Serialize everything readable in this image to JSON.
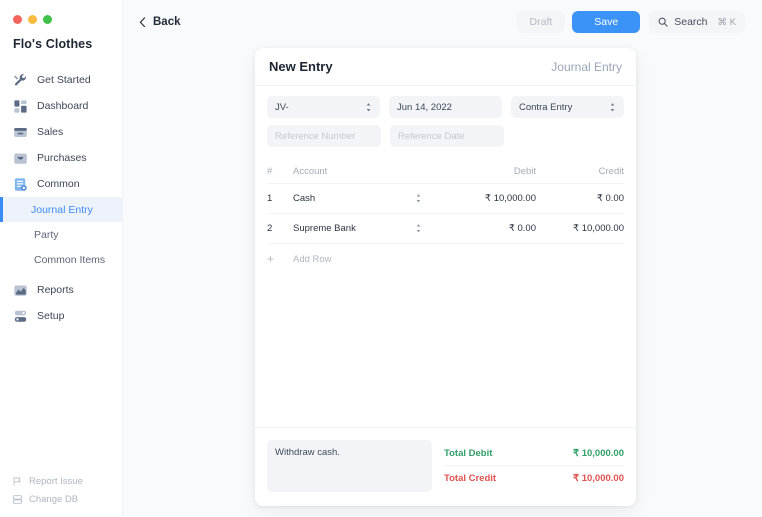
{
  "window": {
    "traffic_lights": [
      "close",
      "minimize",
      "maximize"
    ],
    "accent_blue": "#3b93f7",
    "green": "#2f9e68",
    "red": "#e0524f"
  },
  "sidebar": {
    "brand": "Flo's Clothes",
    "items": [
      {
        "label": "Get Started",
        "icon": "tools-icon"
      },
      {
        "label": "Dashboard",
        "icon": "dashboard-icon"
      },
      {
        "label": "Sales",
        "icon": "sales-icon"
      },
      {
        "label": "Purchases",
        "icon": "purchases-icon"
      },
      {
        "label": "Common",
        "icon": "common-icon"
      }
    ],
    "sub_items": [
      {
        "label": "Journal Entry",
        "active": true
      },
      {
        "label": "Party",
        "active": false
      },
      {
        "label": "Common Items",
        "active": false
      }
    ],
    "items_after": [
      {
        "label": "Reports",
        "icon": "reports-icon"
      },
      {
        "label": "Setup",
        "icon": "setup-icon"
      }
    ],
    "footer": [
      {
        "label": "Report Issue",
        "icon": "flag-icon"
      },
      {
        "label": "Change DB",
        "icon": "database-icon"
      }
    ]
  },
  "toolbar": {
    "back_label": "Back",
    "draft_label": "Draft",
    "save_label": "Save",
    "search_label": "Search",
    "search_shortcut": "⌘ K"
  },
  "card": {
    "title": "New Entry",
    "subtitle": "Journal Entry",
    "fields": {
      "entry_type_value": "JV-",
      "date_value": "Jun 14, 2022",
      "journal_type_value": "Contra Entry",
      "reference_number_placeholder": "Reference Number",
      "reference_date_placeholder": "Reference Date"
    },
    "table": {
      "columns": [
        "#",
        "Account",
        "Debit",
        "Credit"
      ],
      "rows": [
        {
          "index": "1",
          "account": "Cash",
          "debit": "₹ 10,000.00",
          "credit": "₹ 0.00"
        },
        {
          "index": "2",
          "account": "Supreme Bank",
          "debit": "₹ 0.00",
          "credit": "₹ 10,000.00"
        }
      ],
      "add_row_label": "Add Row",
      "add_row_icon": "plus-icon"
    },
    "footer": {
      "notes_value": "Withdraw cash.",
      "total_debit_label": "Total Debit",
      "total_debit_value": "₹ 10,000.00",
      "total_credit_label": "Total Credit",
      "total_credit_value": "₹ 10,000.00"
    }
  }
}
